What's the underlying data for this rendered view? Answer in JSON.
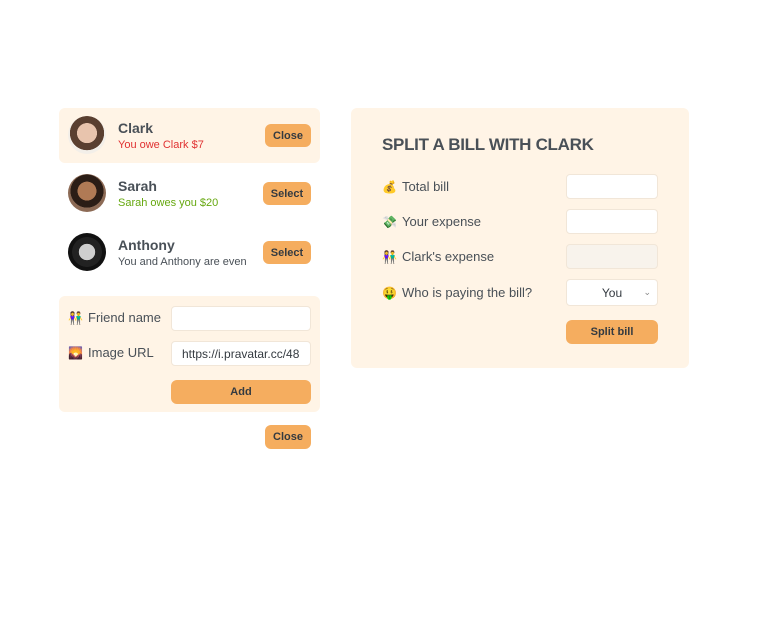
{
  "friends": [
    {
      "name": "Clark",
      "status": "You owe Clark $7",
      "status_color": "#e03131",
      "button": "Close",
      "selected": true
    },
    {
      "name": "Sarah",
      "status": "Sarah owes you $20",
      "status_color": "#66a80f",
      "button": "Select",
      "selected": false
    },
    {
      "name": "Anthony",
      "status": "You and Anthony are even",
      "status_color": "#495057",
      "button": "Select",
      "selected": false
    }
  ],
  "add_form": {
    "name_icon": "👫",
    "name_label": "Friend name",
    "name_value": "",
    "image_icon": "🌄",
    "image_label": "Image URL",
    "image_value": "https://i.pravatar.cc/48",
    "add_label": "Add"
  },
  "close_form_label": "Close",
  "split": {
    "title": "SPLIT A BILL WITH CLARK",
    "total_icon": "💰",
    "total_label": "Total bill",
    "total_value": "",
    "your_icon": "💸",
    "your_label": "Your expense",
    "your_value": "",
    "friend_icon": "👫",
    "friend_label": "Clark's expense",
    "friend_value": "",
    "payer_icon": "🤑",
    "payer_label": "Who is paying the bill?",
    "payer_value": "You",
    "submit_label": "Split bill"
  },
  "colors": {
    "accent": "#f5ad5f",
    "panel": "#fff4e6"
  }
}
